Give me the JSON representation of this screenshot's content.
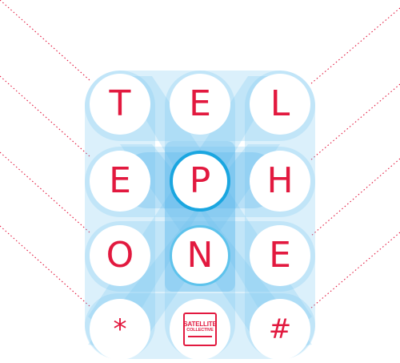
{
  "keypad": {
    "rows": [
      [
        "T",
        "E",
        "L"
      ],
      [
        "E",
        "P",
        "H"
      ],
      [
        "O",
        "N",
        "E"
      ],
      [
        "*",
        "",
        "#"
      ]
    ]
  },
  "logo": {
    "line1": "SATELLITE",
    "line2": "COLLECTIVE"
  },
  "colors": {
    "letter": "#e2193f",
    "ring_highlight": "#1aa6e0",
    "band": "#8fd0f2",
    "dotted_line": "#e2193f"
  }
}
